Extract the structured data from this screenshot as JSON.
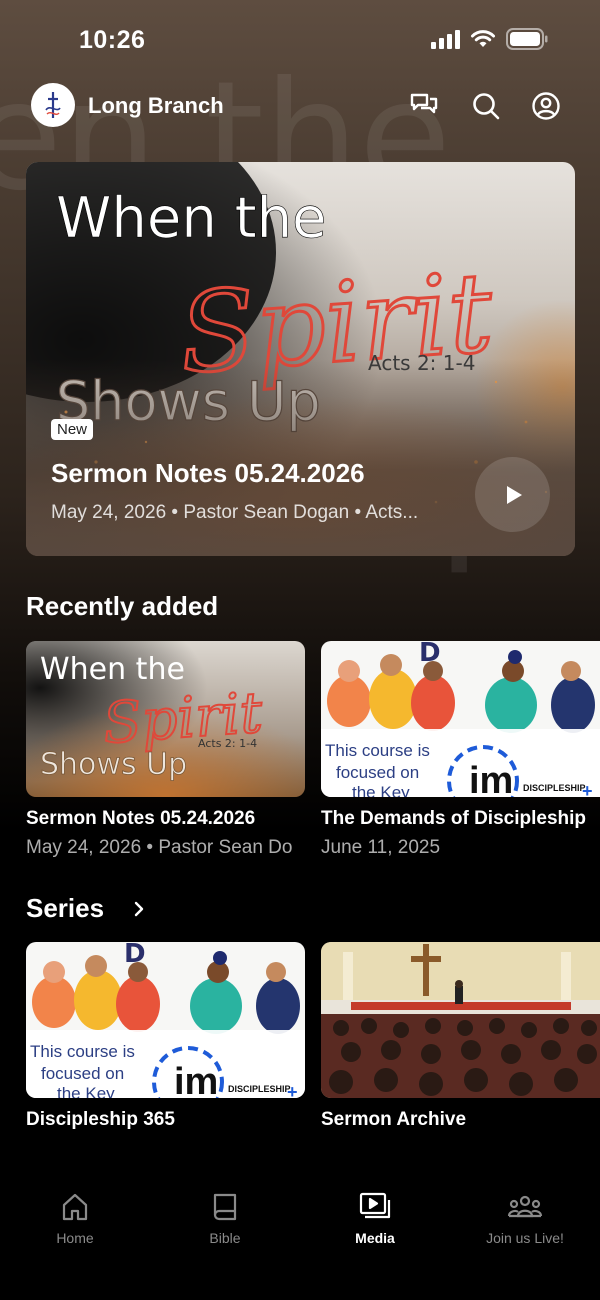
{
  "status_bar": {
    "time": "10:26"
  },
  "header": {
    "brand": "Long Branch"
  },
  "hero": {
    "art": {
      "line1": "When the",
      "script": "Spirit",
      "reference": "Acts 2: 1-4",
      "line2": "Shows Up"
    },
    "badge": "New",
    "title": "Sermon Notes 05.24.2026",
    "meta": "May 24, 2026 • Pastor Sean Dogan • Acts..."
  },
  "recently_added": {
    "heading": "Recently added",
    "items": [
      {
        "title": "Sermon Notes 05.24.2026",
        "meta": "May 24, 2026 • Pastor Sean Do"
      },
      {
        "title": "The Demands of Discipleship",
        "meta": "June 11, 2025"
      }
    ]
  },
  "series": {
    "heading": "Series",
    "items": [
      {
        "title": "Discipleship 365"
      },
      {
        "title": "Sermon Archive"
      }
    ]
  },
  "thumb_text": {
    "course_line1": "This course is",
    "course_line2": "focused on",
    "course_line3": "the Key",
    "im": "im",
    "discipleship": "DISCIPLESHIP"
  },
  "tabs": [
    {
      "label": "Home",
      "icon": "home-icon"
    },
    {
      "label": "Bible",
      "icon": "book-icon"
    },
    {
      "label": "Media",
      "icon": "media-icon",
      "active": true
    },
    {
      "label": "Join us Live!",
      "icon": "people-icon"
    }
  ],
  "colors": {
    "accent_red": "#e0483a",
    "discipleship_blue": "#1e5bd8"
  }
}
